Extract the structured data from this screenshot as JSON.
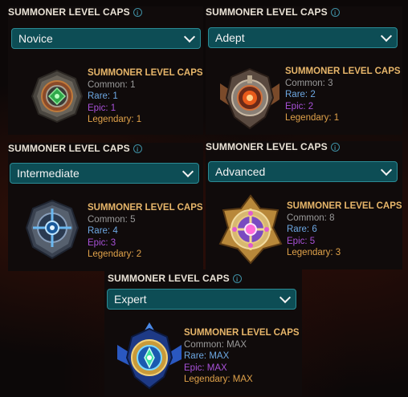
{
  "header_label": "SUMMONER LEVEL CAPS",
  "info_glyph": "i",
  "block_title": "SUMMONER LEVEL CAPS",
  "labels": {
    "common": "Common:",
    "rare": "Rare:",
    "epic": "Epic:",
    "legendary": "Legendary:"
  },
  "colors": {
    "select_bg": "#0d4d55",
    "title": "#e7b66a",
    "common": "#9a9a9a",
    "rare": "#6da8e3",
    "epic": "#a851d8",
    "legendary": "#e0a24a"
  },
  "tiers": [
    {
      "name": "Novice",
      "icon": "novice-emblem-icon",
      "common": "1",
      "rare": "1",
      "epic": "1",
      "legendary": "1"
    },
    {
      "name": "Adept",
      "icon": "adept-emblem-icon",
      "common": "3",
      "rare": "2",
      "epic": "2",
      "legendary": "1"
    },
    {
      "name": "Intermediate",
      "icon": "intermediate-emblem-icon",
      "common": "5",
      "rare": "4",
      "epic": "3",
      "legendary": "2"
    },
    {
      "name": "Advanced",
      "icon": "advanced-emblem-icon",
      "common": "8",
      "rare": "6",
      "epic": "5",
      "legendary": "3"
    },
    {
      "name": "Expert",
      "icon": "expert-emblem-icon",
      "common": "MAX",
      "rare": "MAX",
      "epic": "MAX",
      "legendary": "MAX"
    }
  ]
}
